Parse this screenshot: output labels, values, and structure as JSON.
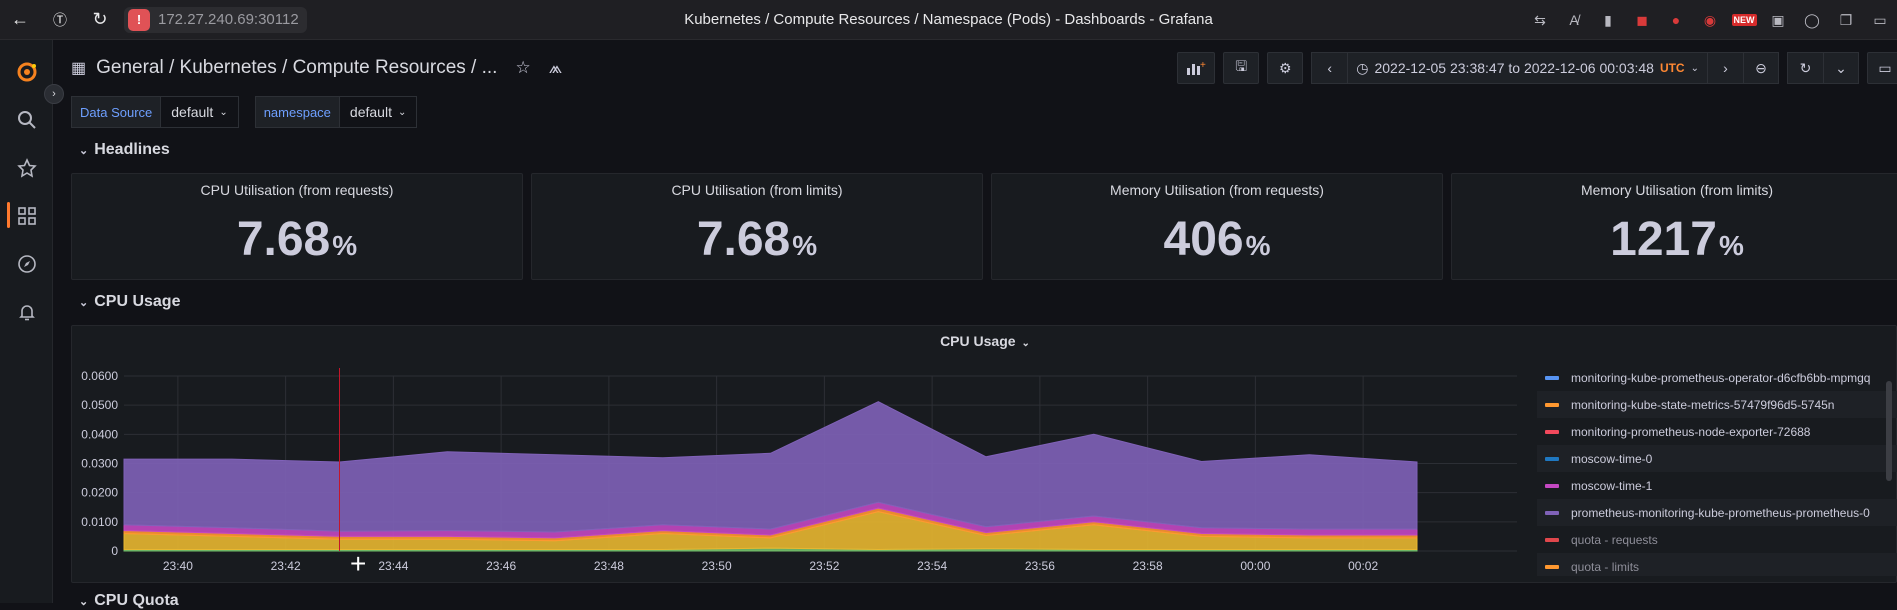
{
  "browser": {
    "url": "172.27.240.69:30112",
    "title": "Kubernetes / Compute Resources / Namespace (Pods) - Dashboards - Grafana",
    "ext_new_tag": "NEW"
  },
  "topnav": {
    "breadcrumb": "General  / Kubernetes / Compute Resources / ...",
    "time_range": "2022-12-05 23:38:47 to 2022-12-06 00:03:48",
    "timezone": "UTC"
  },
  "variables": [
    {
      "label": "Data Source",
      "value": "default"
    },
    {
      "label": "namespace",
      "value": "default"
    }
  ],
  "rows": {
    "headlines": "Headlines",
    "cpu_usage": "CPU Usage",
    "cpu_quota": "CPU Quota"
  },
  "stats": [
    {
      "title": "CPU Utilisation (from requests)",
      "value": "7.68",
      "unit": "%"
    },
    {
      "title": "CPU Utilisation (from limits)",
      "value": "7.68",
      "unit": "%"
    },
    {
      "title": "Memory Utilisation (from requests)",
      "value": "406",
      "unit": "%"
    },
    {
      "title": "Memory Utilisation (from limits)",
      "value": "1217",
      "unit": "%"
    }
  ],
  "graph": {
    "title": "CPU Usage",
    "legend": [
      {
        "name": "monitoring-kube-prometheus-operator-d6cfb6bb-mpmgq",
        "color": "#5794f2"
      },
      {
        "name": "monitoring-kube-state-metrics-57479f96d5-5745n",
        "color": "#ff9830"
      },
      {
        "name": "monitoring-prometheus-node-exporter-72688",
        "color": "#f2495c"
      },
      {
        "name": "moscow-time-0",
        "color": "#1f78c1"
      },
      {
        "name": "moscow-time-1",
        "color": "#c448c2"
      },
      {
        "name": "prometheus-monitoring-kube-prometheus-prometheus-0",
        "color": "#8062b8"
      },
      {
        "name": "quota - requests",
        "color": "#e0474c"
      },
      {
        "name": "quota - limits",
        "color": "#ff9830"
      }
    ]
  },
  "chart_data": {
    "type": "area",
    "title": "CPU Usage",
    "x": [
      "23:39",
      "23:41",
      "23:43",
      "23:45",
      "23:47",
      "23:49",
      "23:51",
      "23:53",
      "23:55",
      "23:57",
      "23:59",
      "00:01",
      "00:03"
    ],
    "xticks": [
      "23:40",
      "23:42",
      "23:44",
      "23:46",
      "23:48",
      "23:50",
      "23:52",
      "23:54",
      "23:56",
      "23:58",
      "00:00",
      "00:02"
    ],
    "yticks": [
      "0",
      "0.0100",
      "0.0200",
      "0.0300",
      "0.0400",
      "0.0500",
      "0.0600"
    ],
    "ylim": [
      0,
      0.06
    ],
    "stacked": true,
    "series": [
      {
        "name": "green",
        "color": "#73bf69",
        "values": [
          0.0005,
          0.0005,
          0.0005,
          0.0005,
          0.0005,
          0.0005,
          0.001,
          0.0005,
          0.0008,
          0.0005,
          0.0005,
          0.0005,
          0.0005
        ]
      },
      {
        "name": "yellow",
        "color": "#e8b730",
        "values": [
          0.0055,
          0.0045,
          0.0035,
          0.0035,
          0.003,
          0.0055,
          0.0035,
          0.013,
          0.0045,
          0.0085,
          0.0045,
          0.004,
          0.004
        ]
      },
      {
        "name": "orange",
        "color": "#ff9830",
        "values": [
          0.001,
          0.001,
          0.001,
          0.001,
          0.001,
          0.001,
          0.001,
          0.0012,
          0.001,
          0.001,
          0.001,
          0.001,
          0.001
        ]
      },
      {
        "name": "moscow-time-1",
        "color": "#c448c2",
        "values": [
          0.002,
          0.002,
          0.0018,
          0.002,
          0.002,
          0.002,
          0.002,
          0.002,
          0.002,
          0.002,
          0.002,
          0.002,
          0.002
        ]
      },
      {
        "name": "prometheus-monitoring-kube-prometheus-prometheus-0",
        "color": "#8062b8",
        "values": [
          0.0225,
          0.0235,
          0.0237,
          0.027,
          0.0265,
          0.023,
          0.026,
          0.0345,
          0.024,
          0.028,
          0.0227,
          0.0255,
          0.023
        ]
      }
    ]
  }
}
